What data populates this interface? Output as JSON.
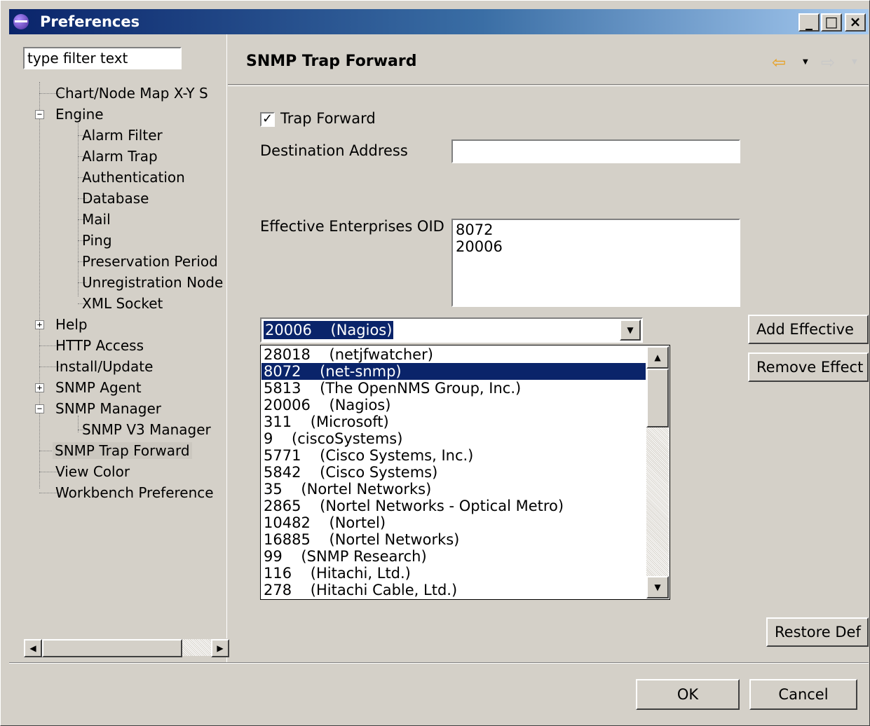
{
  "window": {
    "title": "Preferences"
  },
  "titlebar": {
    "minimize": "_",
    "maximize": "□",
    "close": "×"
  },
  "left": {
    "filter_placeholder": "type filter text",
    "tree": [
      {
        "label": "Chart/Node Map X-Y S"
      },
      {
        "label": "Engine"
      },
      {
        "label": "Alarm Filter"
      },
      {
        "label": "Alarm Trap"
      },
      {
        "label": "Authentication"
      },
      {
        "label": "Database"
      },
      {
        "label": "Mail"
      },
      {
        "label": "Ping"
      },
      {
        "label": "Preservation Period"
      },
      {
        "label": "Unregistration Node"
      },
      {
        "label": "XML Socket"
      },
      {
        "label": "Help"
      },
      {
        "label": "HTTP Access"
      },
      {
        "label": "Install/Update"
      },
      {
        "label": "SNMP Agent"
      },
      {
        "label": "SNMP Manager"
      },
      {
        "label": "SNMP V3 Manager"
      },
      {
        "label": "SNMP Trap Forward"
      },
      {
        "label": "View Color"
      },
      {
        "label": "Workbench  Preference"
      }
    ]
  },
  "page": {
    "title": "SNMP Trap Forward",
    "nav_back_icon": "back-arrow-icon",
    "nav_forward_icon": "forward-arrow-icon"
  },
  "form": {
    "trap_forward_label": "Trap Forward",
    "trap_forward_checked": true,
    "destination_label": "Destination Address",
    "destination_value": "",
    "oid_label": "Effective Enterprises OID",
    "oid_values": [
      "8072",
      "20006"
    ],
    "combo_value": "20006    (Nagios)",
    "dropdown_items": [
      "28018    (netjfwatcher)",
      "8072    (net-snmp)",
      "5813    (The OpenNMS Group, Inc.)",
      "20006    (Nagios)",
      "311    (Microsoft)",
      "9    (ciscoSystems)",
      "5771    (Cisco Systems, Inc.)",
      "5842    (Cisco Systems)",
      "35    (Nortel Networks)",
      "2865    (Nortel Networks - Optical Metro)",
      "10482    (Nortel)",
      "16885    (Nortel Networks)",
      "99    (SNMP Research)",
      "116    (Hitachi, Ltd.)",
      "278    (Hitachi Cable, Ltd.)"
    ],
    "dropdown_selected_index": 1,
    "add_button": "Add Effective",
    "remove_button": "Remove Effect",
    "restore_button": "Restore Def"
  },
  "footer": {
    "ok": "OK",
    "cancel": "Cancel"
  }
}
